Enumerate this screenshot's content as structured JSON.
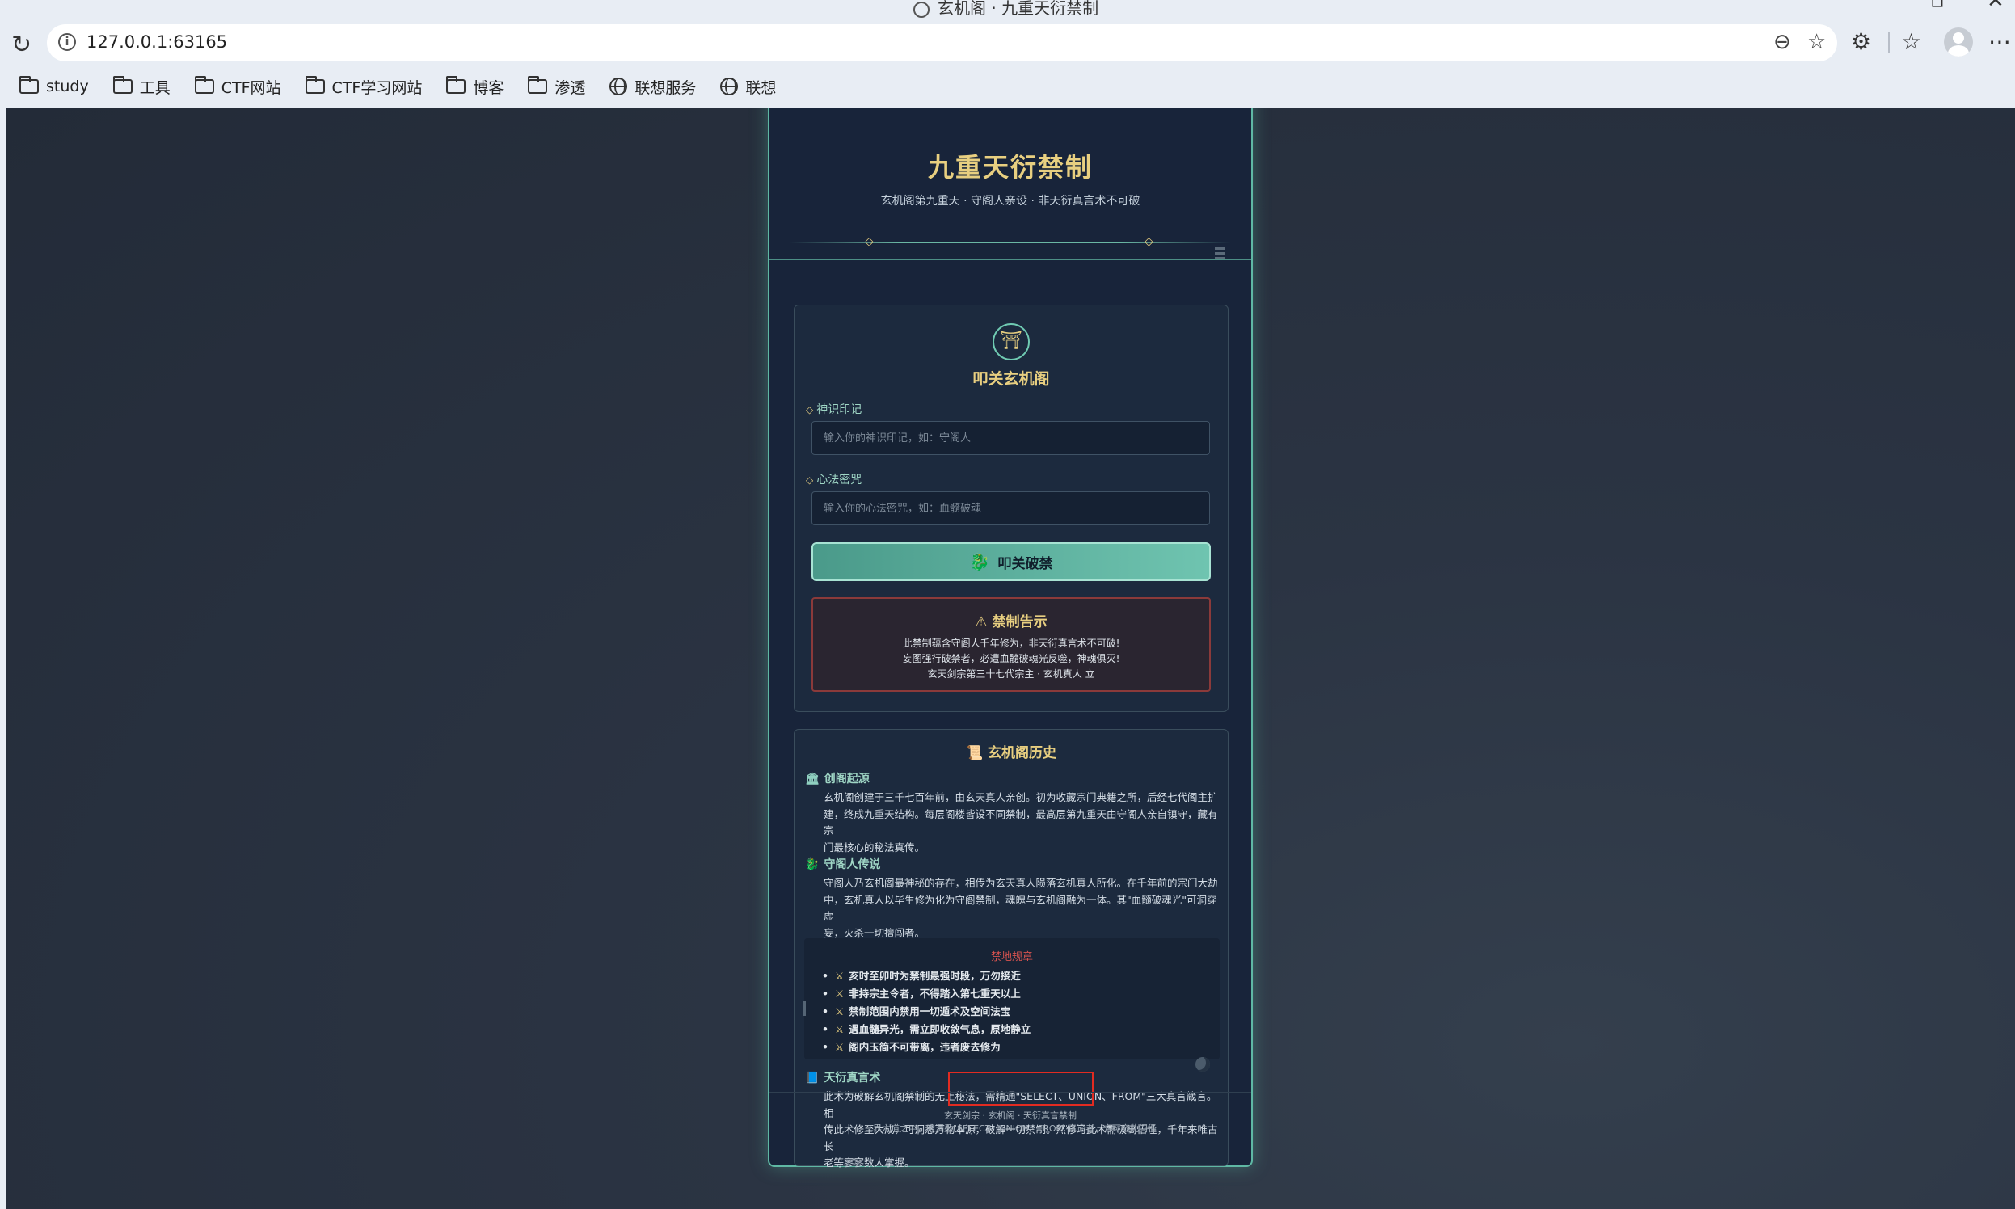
{
  "browser": {
    "window_title": "玄机阁 · 九重天衍禁制",
    "url": "127.0.0.1:63165",
    "bookmarks": [
      {
        "label": "study",
        "icon": "folder-icon"
      },
      {
        "label": "工具",
        "icon": "folder-icon"
      },
      {
        "label": "CTF网站",
        "icon": "folder-icon"
      },
      {
        "label": "CTF学习网站",
        "icon": "folder-icon"
      },
      {
        "label": "博客",
        "icon": "folder-icon"
      },
      {
        "label": "渗透",
        "icon": "folder-icon"
      },
      {
        "label": "联想服务",
        "icon": "globe-icon"
      },
      {
        "label": "联想",
        "icon": "globe-icon"
      }
    ]
  },
  "header": {
    "title": "九重天衍禁制",
    "subtitle": "玄机阁第九重天 · 守阁人亲设 · 非天衍真言术不可破"
  },
  "login": {
    "title": "叩关玄机阁",
    "username_label": "神识印记",
    "username_placeholder": "输入你的神识印记，如：守阁人",
    "password_label": "心法密咒",
    "password_placeholder": "输入你的心法密咒，如：血髓破魂",
    "submit_label": "叩关破禁"
  },
  "warning": {
    "title": "禁制告示",
    "lines": [
      "此禁制蕴含守阁人千年修为，非天衍真言术不可破!",
      "妄图强行破禁者，必遭血髓破魂光反噬，神魂俱灭!",
      "玄天剑宗第三十七代宗主 · 玄机真人 立"
    ]
  },
  "history": {
    "title": "玄机阁历史",
    "sections": [
      {
        "title": "创阁起源",
        "lines": [
          "玄机阁创建于三千七百年前，由玄天真人亲创。初为收藏宗门典籍之所，后经七代阁主扩",
          "建，终成九重天结构。每层阁楼皆设不同禁制，最高层第九重天由守阁人亲自镇守，藏有宗",
          "门最核心的秘法真传。"
        ]
      },
      {
        "title": "守阁人传说",
        "lines": [
          "守阁人乃玄机阁最神秘的存在，相传为玄天真人陨落玄机真人所化。在千年前的宗门大劫",
          "中，玄机真人以毕生修为化为守阁禁制，魂魄与玄机阁融为一体。其\"血髓破魂光\"可洞穿虚",
          "妄，灭杀一切擅闯者。"
        ]
      },
      {
        "title": "天衍真言术",
        "lines": [
          "此术为破解玄机阁禁制的无上秘法，需精通\"SELECT、UNION、FROM\"三大真言箴言。相",
          "传此术修至大成，可洞悉万物本源，破解一切禁制。然修习此术需极高悟性，千年来唯古长",
          "老等寥寥数人掌握。"
        ]
      }
    ],
    "rules": {
      "title": "禁地规章",
      "items": [
        "亥时至卯时为禁制最强时段，万勿接近",
        "非持宗主令者，不得踏入第七重天以上",
        "禁制范围内禁用一切遁术及空间法宝",
        "遇血髓异光，需立即收敛气息，原地静立",
        "阁内玉简不可带离，违者废去修为"
      ]
    }
  },
  "footer": {
    "line1": "玄天剑宗 · 玄机阁 · 天衍真言禁制",
    "line2": "三界六道之中，唯洞悉\"SELECT、UNION、FROM\"真谛者，方可窥此门径"
  },
  "colors": {
    "accent_gold": "#e8cf80",
    "accent_teal": "#6fc4b0",
    "warning_red": "#8b3a3a",
    "highlight_box": "#e22b21"
  }
}
